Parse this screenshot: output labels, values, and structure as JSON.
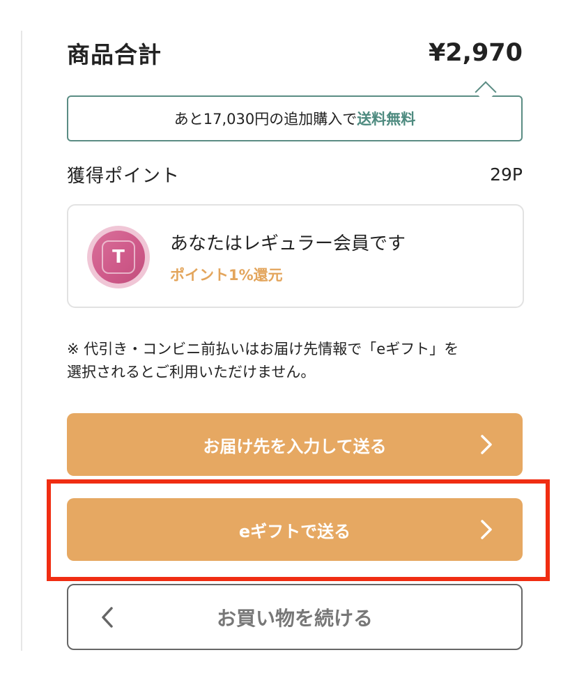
{
  "summary": {
    "total_label": "商品合計",
    "total_value": "¥2,970",
    "shipping_notice_prefix": "あと17,030円の追加購入で",
    "shipping_notice_highlight": "送料無料",
    "points_label": "獲得ポイント",
    "points_value": "29P"
  },
  "member": {
    "coin_letter": "T",
    "title": "あなたはレギュラー会員です",
    "subtitle": "ポイント1%還元"
  },
  "note": {
    "line1": "※ 代引き・コンビニ前払いはお届け先情報で「eギフト」を",
    "line2": "選択されるとご利用いただけません。"
  },
  "buttons": {
    "address": "お届け先を入力して送る",
    "egift": "eギフトで送る",
    "continue": "お買い物を続ける"
  },
  "colors": {
    "accent_orange": "#e6a862",
    "accent_green": "#4d8a7f",
    "highlight_red": "#f02d12",
    "member_pink": "#cf5a8a"
  },
  "icons": {
    "button_arrow": "chevron-right-icon",
    "back_arrow": "chevron-left-icon",
    "member_badge": "t-point-coin-icon"
  }
}
